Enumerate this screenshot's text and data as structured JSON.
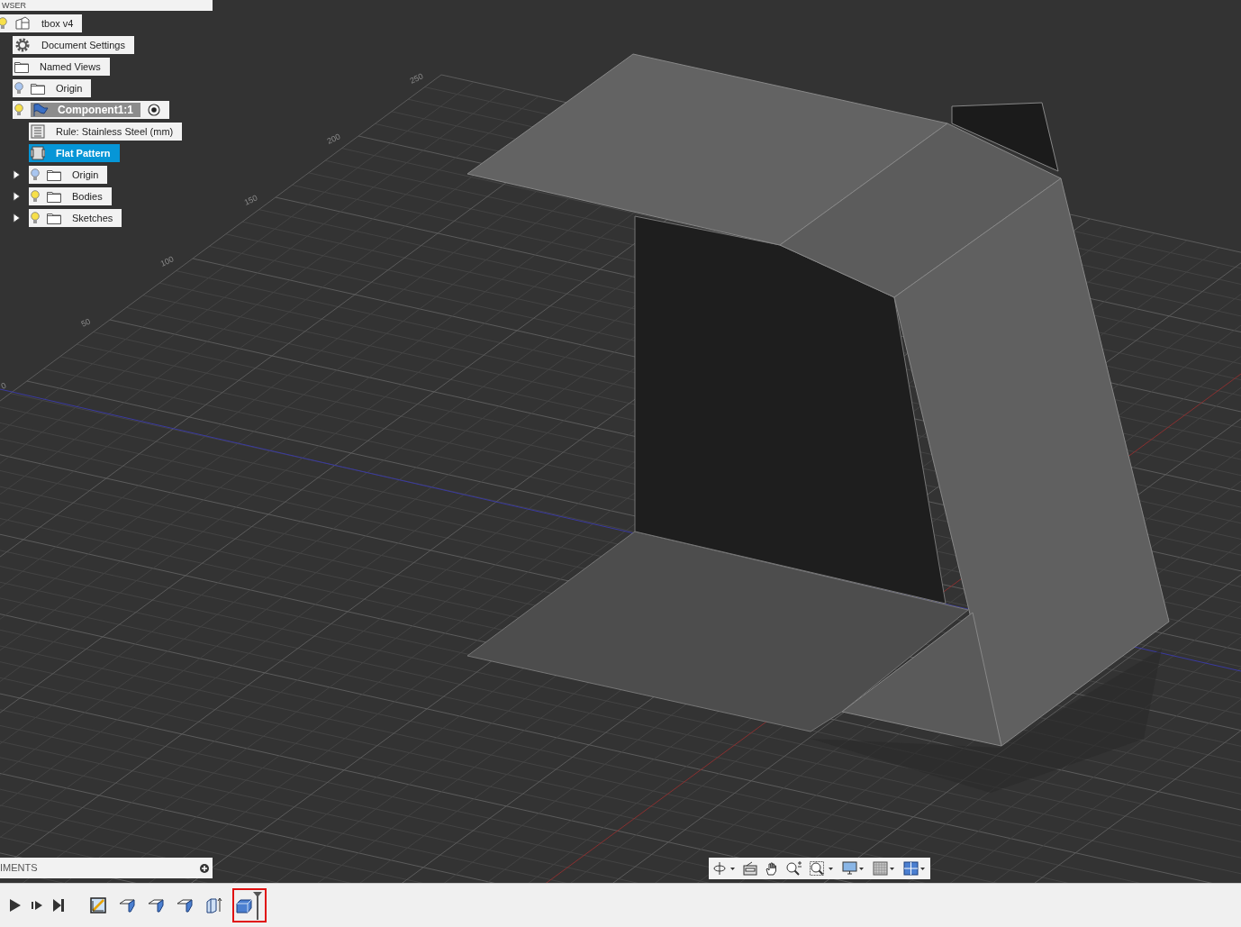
{
  "browser": {
    "header": "WSER",
    "items": [
      {
        "label": "tbox v4",
        "kind": "component",
        "visible": true,
        "selected": false,
        "children": [
          {
            "label": "Document Settings",
            "kind": "settings",
            "selected": false
          },
          {
            "label": "Named Views",
            "kind": "folder",
            "selected": false
          },
          {
            "label": "Origin",
            "kind": "folder",
            "visible": false,
            "selected": false
          },
          {
            "label": "Component1:1",
            "kind": "flag",
            "visible": true,
            "active": true,
            "selected": false,
            "children": [
              {
                "label": "Rule: Stainless Steel (mm)",
                "kind": "rule",
                "selected": false
              },
              {
                "label": "Flat Pattern",
                "kind": "flat",
                "selected": true
              },
              {
                "label": "Origin",
                "kind": "folder",
                "visible": false,
                "expanded": false,
                "selected": false
              },
              {
                "label": "Bodies",
                "kind": "folder",
                "visible": true,
                "expanded": false,
                "selected": false
              },
              {
                "label": "Sketches",
                "kind": "folder",
                "visible": true,
                "expanded": false,
                "selected": false
              }
            ]
          }
        ]
      }
    ]
  },
  "viewport": {
    "grid_labels": [
      "250",
      "200",
      "150",
      "100",
      "50",
      "0"
    ]
  },
  "comments": {
    "title": "IMENTS"
  },
  "timeline": {
    "features": [
      {
        "kind": "sketch",
        "selected": false
      },
      {
        "kind": "flange",
        "selected": false
      },
      {
        "kind": "flange",
        "selected": false
      },
      {
        "kind": "flange",
        "selected": false
      },
      {
        "kind": "extrude",
        "selected": false
      },
      {
        "kind": "flat",
        "selected": true
      }
    ]
  }
}
